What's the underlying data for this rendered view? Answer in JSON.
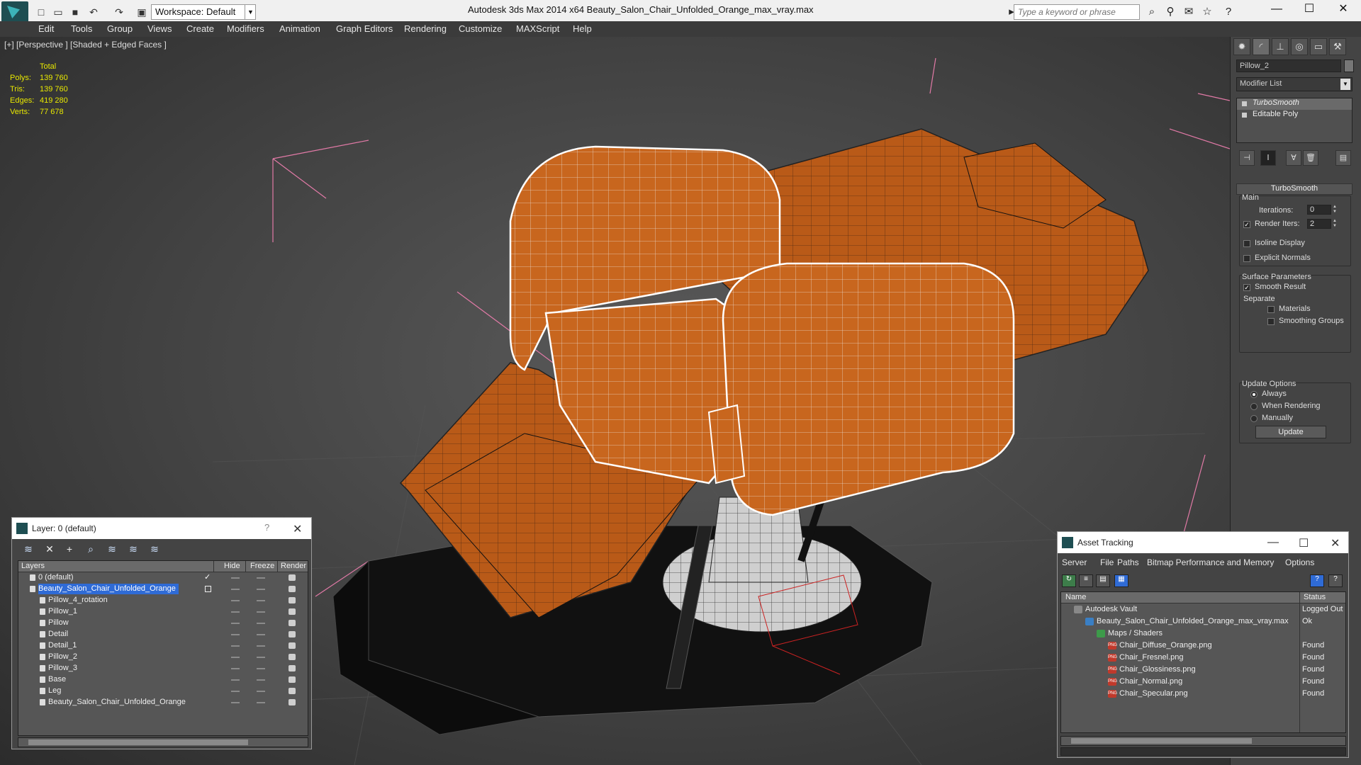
{
  "titlebar": {
    "workspace": "Workspace: Default",
    "title": "Autodesk 3ds Max  2014 x64      Beauty_Salon_Chair_Unfolded_Orange_max_vray.max",
    "search_placeholder": "Type a keyword or phrase"
  },
  "menu": [
    "Edit",
    "Tools",
    "Group",
    "Views",
    "Create",
    "Modifiers",
    "Animation",
    "Graph Editors",
    "Rendering",
    "Customize",
    "MAXScript",
    "Help"
  ],
  "viewport": {
    "label": "[+] [Perspective ] [Shaded + Edged Faces ]",
    "stats": {
      "header": "Total",
      "rows": [
        {
          "k": "Polys:",
          "v": "139 760"
        },
        {
          "k": "Tris:",
          "v": "139 760"
        },
        {
          "k": "Edges:",
          "v": "419 280"
        },
        {
          "k": "Verts:",
          "v": "77 678"
        }
      ]
    }
  },
  "command_panel": {
    "object_name": "Pillow_2",
    "modifier_list": "Modifier List",
    "stack": [
      "TurboSmooth",
      "Editable Poly"
    ],
    "rollout": "TurboSmooth",
    "main_group": "Main",
    "iterations_label": "Iterations:",
    "iterations": "0",
    "render_iters_label": "Render Iters:",
    "render_iters": "2",
    "isoline": "Isoline Display",
    "explicit_normals": "Explicit Normals",
    "surface_group": "Surface Parameters",
    "smooth_result": "Smooth Result",
    "separate": "Separate",
    "materials": "Materials",
    "smoothing_groups": "Smoothing Groups",
    "update_group": "Update Options",
    "always": "Always",
    "when_rendering": "When Rendering",
    "manually": "Manually",
    "update_button": "Update"
  },
  "layer_dialog": {
    "title": "Layer: 0 (default)",
    "columns": {
      "layers": "Layers",
      "hide": "Hide",
      "freeze": "Freeze",
      "render": "Render"
    },
    "rows": [
      {
        "name": "0 (default)",
        "indent": 1
      },
      {
        "name": "Beauty_Salon_Chair_Unfolded_Orange",
        "indent": 1
      },
      {
        "name": "Pillow_4_rotation",
        "indent": 2
      },
      {
        "name": "Pillow_1",
        "indent": 2
      },
      {
        "name": "Pillow",
        "indent": 2
      },
      {
        "name": "Detail",
        "indent": 2
      },
      {
        "name": "Detail_1",
        "indent": 2
      },
      {
        "name": "Pillow_2",
        "indent": 2
      },
      {
        "name": "Pillow_3",
        "indent": 2
      },
      {
        "name": "Base",
        "indent": 2
      },
      {
        "name": "Leg",
        "indent": 2
      },
      {
        "name": "Beauty_Salon_Chair_Unfolded_Orange",
        "indent": 2
      }
    ]
  },
  "asset_dialog": {
    "title": "Asset Tracking",
    "menu": [
      "Server",
      "File",
      "Paths",
      "Bitmap Performance and Memory",
      "Options"
    ],
    "columns": {
      "name": "Name",
      "status": "Status"
    },
    "rows": [
      {
        "name": "Autodesk Vault",
        "status": "Logged Out",
        "indent": 0,
        "icon": "vault-icon"
      },
      {
        "name": "Beauty_Salon_Chair_Unfolded_Orange_max_vray.max",
        "status": "Ok",
        "indent": 1,
        "icon": "max-file-icon"
      },
      {
        "name": "Maps / Shaders",
        "status": "",
        "indent": 2,
        "icon": "maps-icon"
      },
      {
        "name": "Chair_Diffuse_Orange.png",
        "status": "Found",
        "indent": 3,
        "icon": "png-icon"
      },
      {
        "name": "Chair_Fresnel.png",
        "status": "Found",
        "indent": 3,
        "icon": "png-icon"
      },
      {
        "name": "Chair_Glossiness.png",
        "status": "Found",
        "indent": 3,
        "icon": "png-icon"
      },
      {
        "name": "Chair_Normal.png",
        "status": "Found",
        "indent": 3,
        "icon": "png-icon"
      },
      {
        "name": "Chair_Specular.png",
        "status": "Found",
        "indent": 3,
        "icon": "png-icon"
      }
    ]
  }
}
